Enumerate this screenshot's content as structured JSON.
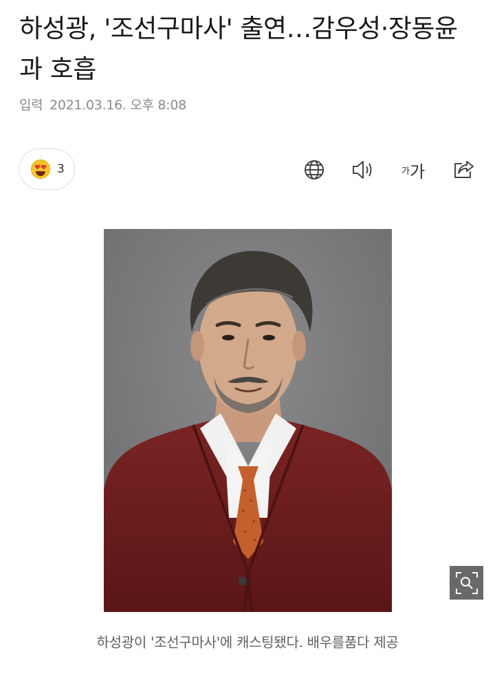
{
  "article": {
    "title": "하성광, '조선구마사' 출연…감우성·장동윤과 호흡",
    "meta_label": "입력",
    "datetime": "2021.03.16. 오후 8:08"
  },
  "reaction": {
    "icon": "heart-eyes-emoji-icon",
    "count": "3"
  },
  "toolbar": {
    "translate_icon": "globe-icon",
    "tts_icon": "speaker-icon",
    "font_small": "가",
    "font_big": "가",
    "share_icon": "share-icon"
  },
  "photo": {
    "zoom_icon": "magnify-icon",
    "caption": "하성광이 '조선구마사'에 캐스팅됐다. 배우를품다 제공"
  },
  "colors": {
    "title": "#1a1a1a",
    "meta": "#8a8a8a",
    "caption": "#5f5f5f",
    "photo_background": "#7b7b7d",
    "cardigan": "#6b1e1e"
  }
}
